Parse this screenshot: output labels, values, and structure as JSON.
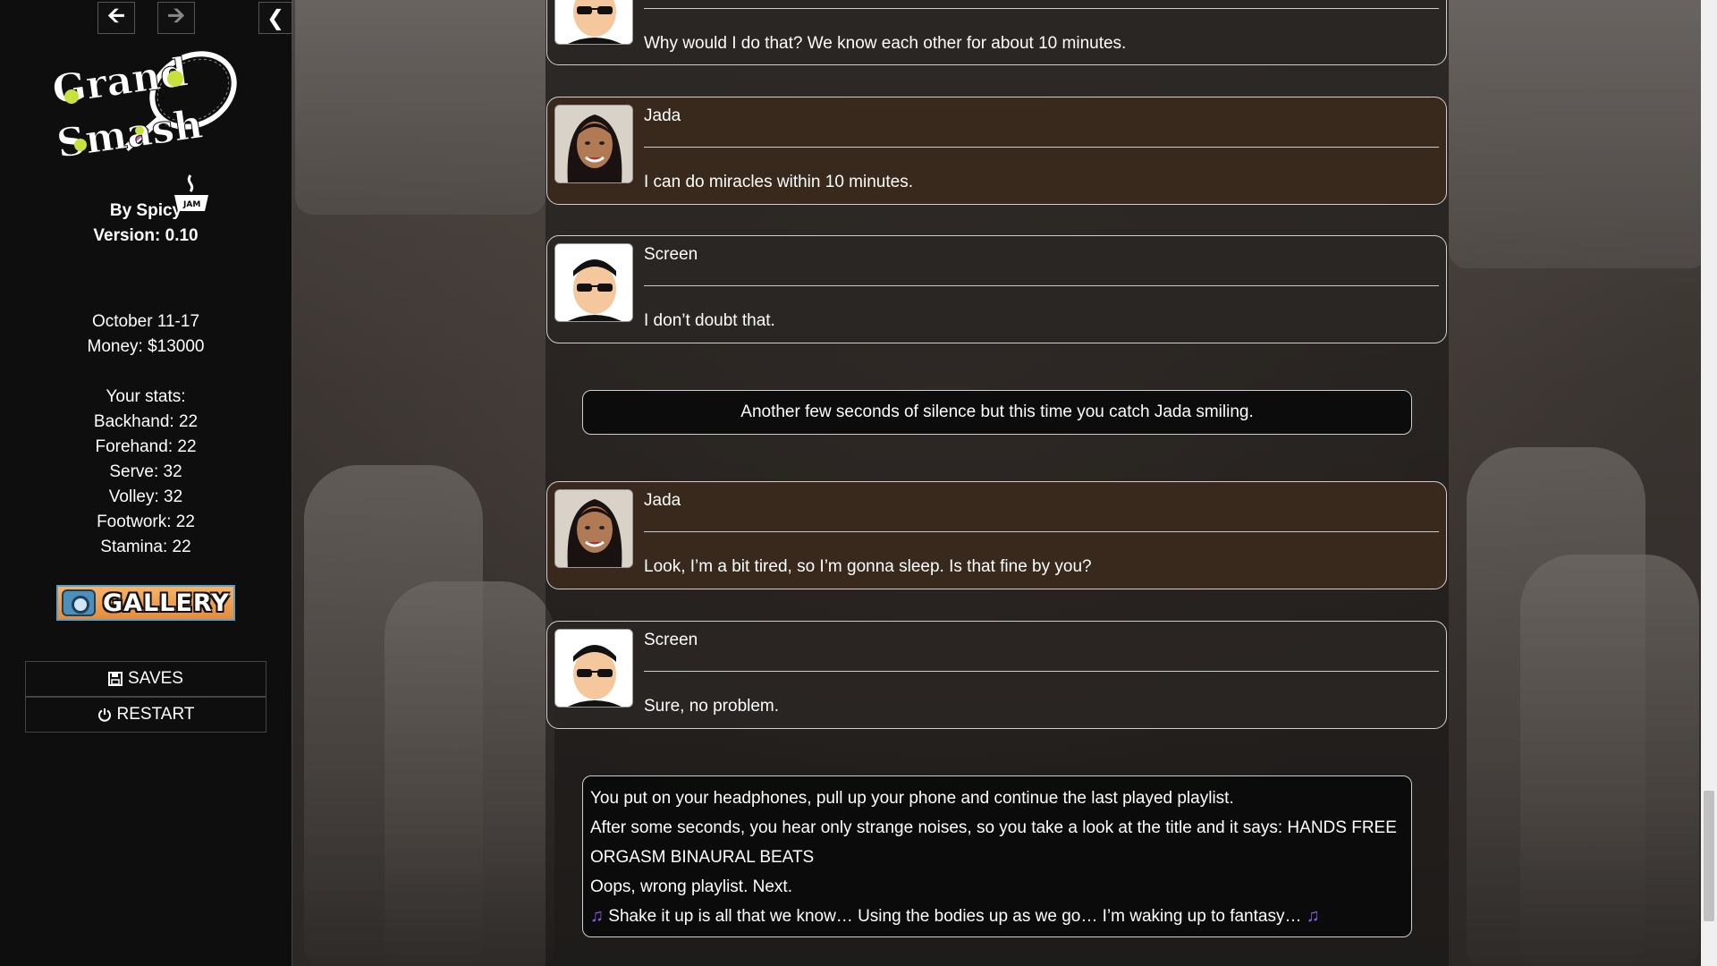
{
  "sidebar": {
    "nav": {
      "back_icon": "arrow-left-icon",
      "forward_icon": "arrow-right-icon",
      "collapse_icon": "chevron-left-icon"
    },
    "logo": {
      "line1": "Grand",
      "line2": "Smash",
      "brand_mark": "JAM"
    },
    "byline": "By Spicy",
    "version": "Version: 0.10",
    "date": "October 11-17",
    "money": "Money: $13000",
    "stats_title": "Your stats:",
    "stats": [
      "Backhand: 22",
      "Forehand: 22",
      "Serve: 32",
      "Volley: 32",
      "Footwork: 22",
      "Stamina: 22"
    ],
    "gallery_label": "GALLERY",
    "saves_label": "SAVES",
    "restart_label": "RESTART"
  },
  "story": {
    "dialogues": [
      {
        "speaker": "",
        "line": "Why would I do that? We know each other for about 10 minutes.",
        "avatar": "screen-avatar"
      },
      {
        "speaker": "Jada",
        "line": "I can do miracles within 10 minutes.",
        "avatar": "jada-avatar"
      },
      {
        "speaker": "Screen",
        "line": "I don’t doubt that.",
        "avatar": "screen-avatar"
      },
      {
        "speaker": "Jada",
        "line": "Look, I’m a bit tired, so I’m gonna sleep. Is that fine by you?",
        "avatar": "jada-avatar"
      },
      {
        "speaker": "Screen",
        "line": "Sure, no problem.",
        "avatar": "screen-avatar"
      }
    ],
    "narration1": "Another few seconds of silence but this time you catch Jada smiling.",
    "narration2": [
      "You put on your headphones, pull up your phone and continue the last played playlist.",
      "After some seconds, you hear only strange noises, so you take a look at the title and it says: HANDS FREE ORGASM BINAURAL BEATS",
      "Oops, wrong playlist. Next.",
      "Shake it up is all that we know… Using the bodies up as we go… I’m waking up to fantasy…"
    ],
    "music_icon": "music-note-icon"
  },
  "colors": {
    "sidebar_bg": "#0e0e0e",
    "jada_box": "#3a2a1c",
    "screen_box": "#2a2624",
    "gallery_orange": "#e58c3c",
    "note_purple": "#8e5cf0"
  }
}
